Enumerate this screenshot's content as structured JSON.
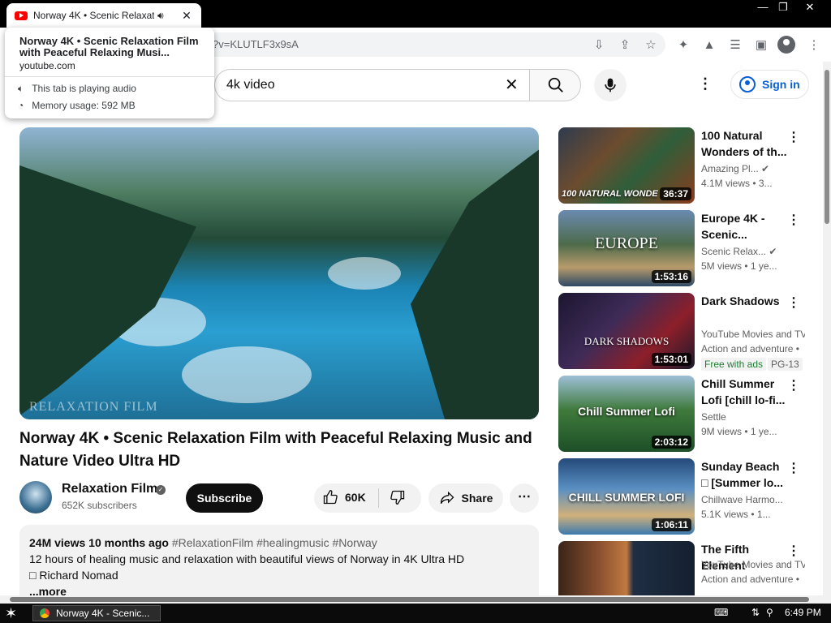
{
  "browser": {
    "tab_title": "Norway 4K • Scenic Relaxation",
    "url_partial": "?v=KLUTLF3x9sA",
    "window_controls": [
      "—",
      "❐",
      "✕"
    ]
  },
  "hover_card": {
    "title": "Norway 4K • Scenic Relaxation Film with Peaceful Relaxing Musi...",
    "domain": "youtube.com",
    "audio_text": "This tab is playing audio",
    "memory_text": "Memory usage: 592 MB"
  },
  "header": {
    "search_value": "4k video",
    "sign_in": "Sign in"
  },
  "video": {
    "watermark": "RELAXATION FILM",
    "title": "Norway 4K • Scenic Relaxation Film with Peaceful Relaxing Music and Nature Video Ultra HD",
    "channel": "Relaxation Film",
    "subscribers": "652K subscribers",
    "subscribe_label": "Subscribe",
    "likes": "60K",
    "share_label": "Share",
    "views": "24M views",
    "age": "10 months ago",
    "tags": "#RelaxationFilm #healingmusic #Norway",
    "description_line": "12 hours of healing music and relaxation with beautiful views of Norway in 4K Ultra HD",
    "description_line2": "□ Richard Nomad",
    "more_label": "...more"
  },
  "recommendations": [
    {
      "title": "100 Natural Wonders of th...",
      "channel": "Amazing Pl...",
      "meta": "4.1M views  • 3...",
      "duration": "36:37",
      "thumb_text": "100 NATURAL WONDE",
      "verified": true
    },
    {
      "title": "Europe 4K - Scenic...",
      "channel": "Scenic Relax...",
      "meta": "5M views  • 1 ye...",
      "duration": "1:53:16",
      "thumb_text": "EUROPE",
      "verified": true
    },
    {
      "title": "Dark Shadows",
      "channel": "YouTube Movies and TV",
      "meta": "Action and adventure •",
      "duration": "1:53:01",
      "thumb_text": "DARK SHADOWS",
      "badge_free": "Free with ads",
      "badge_rating": "PG-13"
    },
    {
      "title": "Chill Summer Lofi [chill lo-fi...",
      "channel": "Settle",
      "meta": "9M views  • 1 ye...",
      "duration": "2:03:12",
      "thumb_text": "Chill Summer Lofi"
    },
    {
      "title": "Sunday Beach □ [Summer lo...",
      "channel": "Chillwave Harmo...",
      "meta": "5.1K views  • 1...",
      "duration": "1:06:11",
      "thumb_text": "CHILL SUMMER LOFI"
    },
    {
      "title": "The Fifth Element",
      "channel": "YouTube Movies and TV",
      "meta": "Action and adventure •",
      "duration": ""
    }
  ],
  "taskbar": {
    "task_label": "Norway 4K - Scenic...",
    "clock": "6:49 PM"
  }
}
